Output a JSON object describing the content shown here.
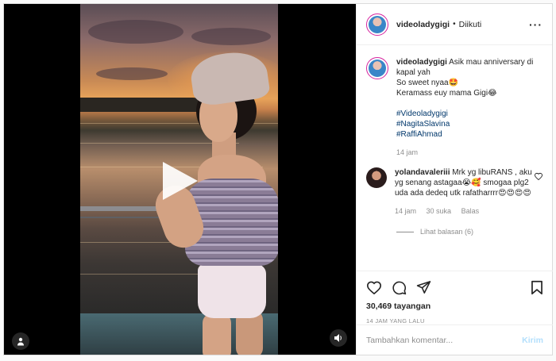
{
  "post": {
    "username": "videoladygigi",
    "follow_status": "Diikuti",
    "separator": "•",
    "more_label": "···",
    "caption": {
      "username": "videoladygigi",
      "line1": "Asik mau anniversary di kapal yah",
      "line2": "So sweet nyaa🤩",
      "line3": "Keramass euy mama Gigi😂",
      "hashtags": [
        "#Videoladygigi",
        "#NagitaSlavina",
        "#RaffiAhmad"
      ],
      "time": "14 jam"
    },
    "comment": {
      "username": "yolandavaleriii",
      "text": "Mrk yg libuRANS , aku yg senang astagaa😭🥰 smogaa plg2 uda ada dedeq utk rafatharrrr😍😍😍😍",
      "time": "14 jam",
      "likes": "30 suka",
      "reply": "Balas",
      "view_replies": "Lihat balasan (6)"
    },
    "views": "30,469 tayangan",
    "posted_ago": "14 JAM YANG LALU",
    "comment_input": {
      "placeholder": "Tambahkan komentar...",
      "post_label": "Kirim"
    }
  },
  "colors": {
    "link": "#00376b",
    "muted": "#8e8e8e",
    "post_button_disabled": "#b2dffc"
  },
  "icons": [
    "play-icon",
    "user-tag-icon",
    "volume-icon",
    "more-icon",
    "heart-icon",
    "comment-icon",
    "share-icon",
    "save-icon"
  ]
}
